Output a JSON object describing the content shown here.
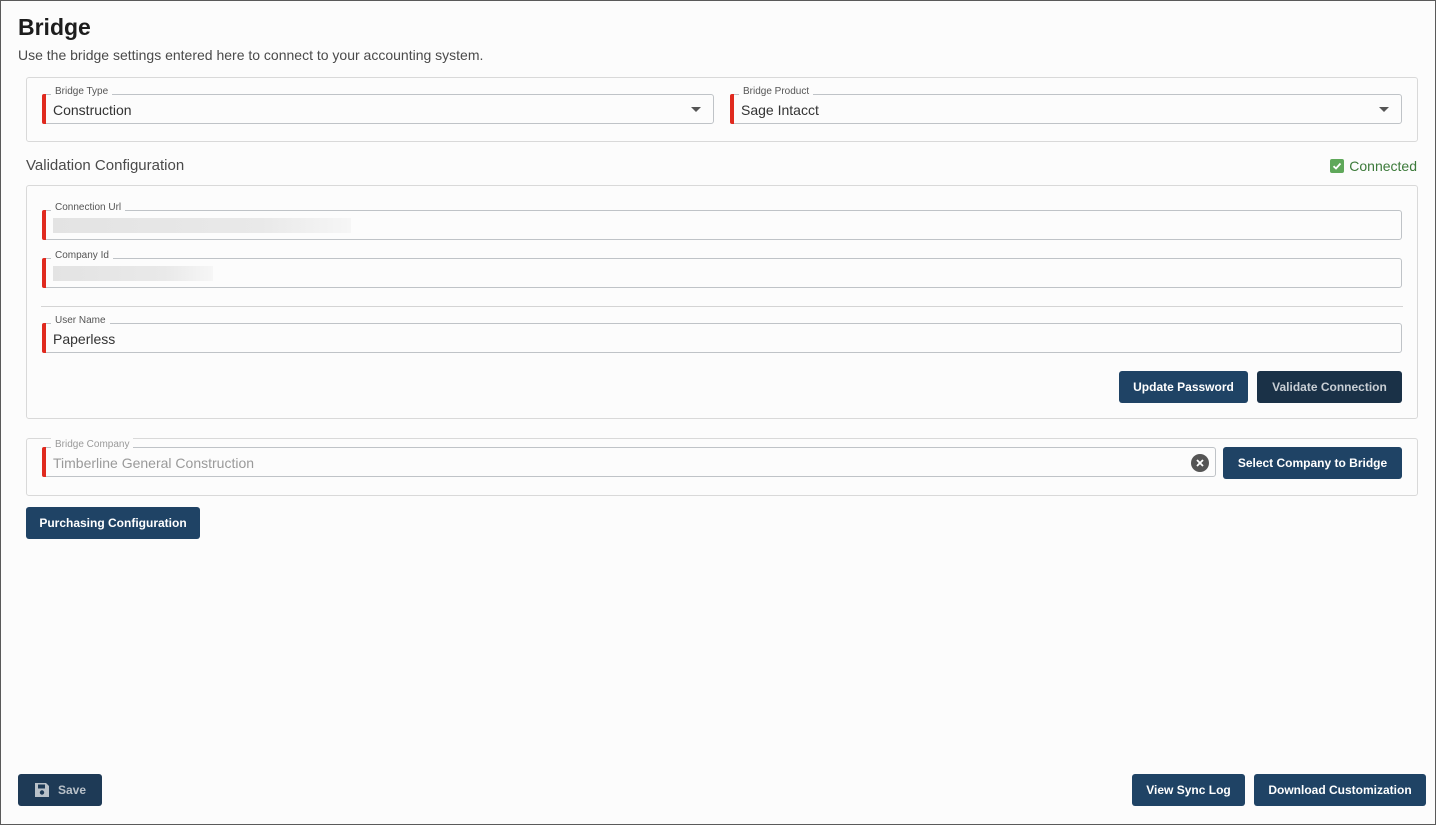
{
  "header": {
    "title": "Bridge",
    "subtitle": "Use the bridge settings entered here to connect to your accounting system."
  },
  "bridge": {
    "type_label": "Bridge Type",
    "type_value": "Construction",
    "product_label": "Bridge Product",
    "product_value": "Sage Intacct"
  },
  "validation": {
    "title": "Validation Configuration",
    "status": "Connected",
    "connection_url_label": "Connection Url",
    "company_id_label": "Company Id",
    "user_name_label": "User Name",
    "user_name_value": "Paperless",
    "update_password_label": "Update Password",
    "validate_connection_label": "Validate Connection"
  },
  "company": {
    "label": "Bridge Company",
    "placeholder": "Timberline General Construction",
    "select_button_label": "Select Company to Bridge"
  },
  "purchasing_button_label": "Purchasing Configuration",
  "footer": {
    "save_label": "Save",
    "view_sync_log_label": "View Sync Log",
    "download_customization_label": "Download Customization"
  },
  "colors": {
    "primary_button": "#1f4365",
    "required_marker": "#e02a1f",
    "connected": "#3c7a3a"
  }
}
